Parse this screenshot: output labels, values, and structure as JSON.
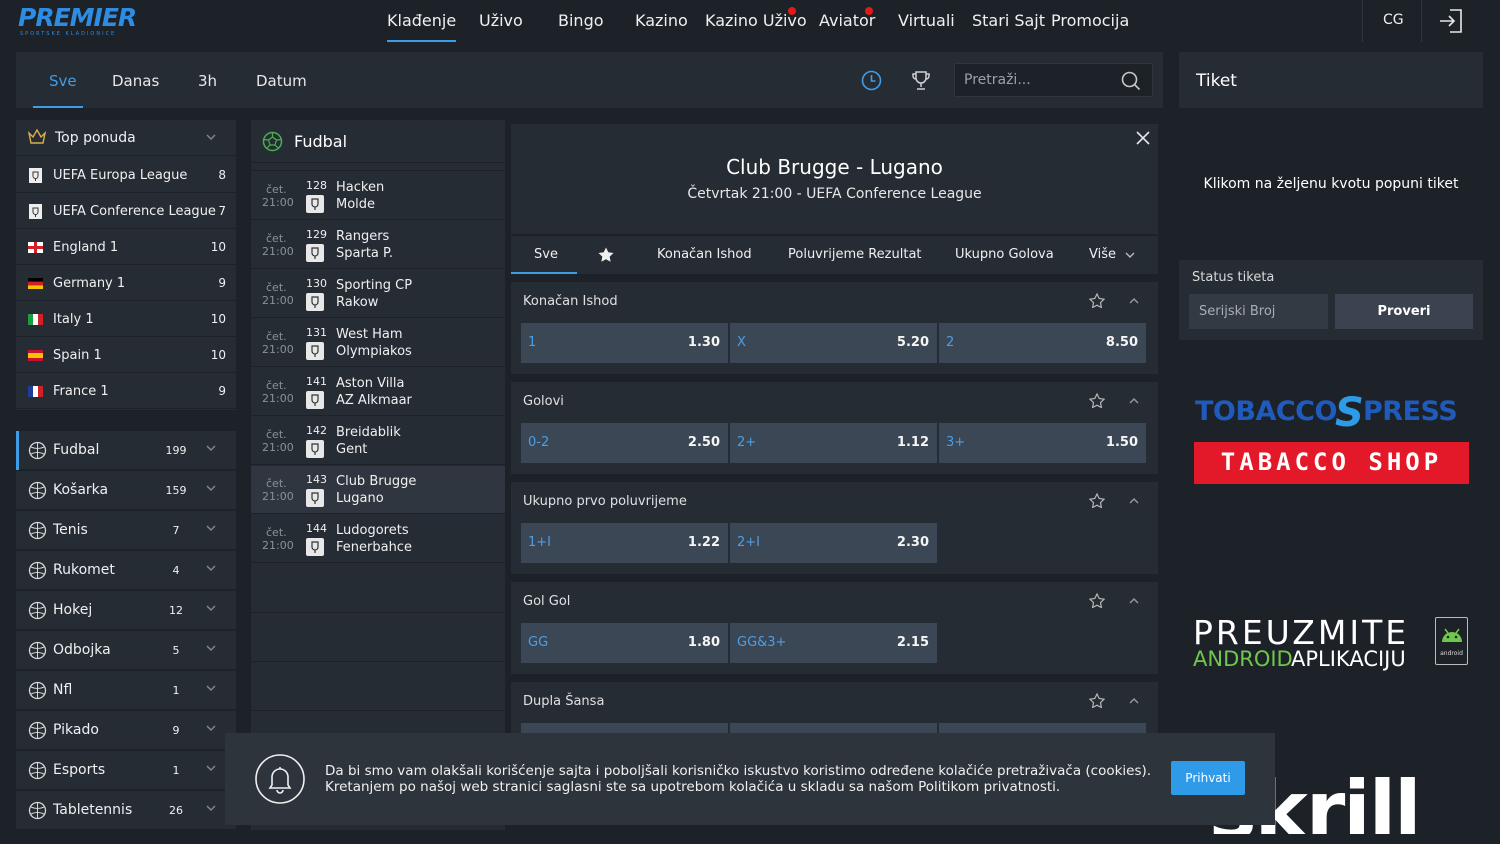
{
  "brand": {
    "name": "PREMIER",
    "tagline": "SPORTSKE KLADIONICE",
    "color": "#2e8de3"
  },
  "nav": {
    "items": [
      "Klađenje",
      "Uživo",
      "Bingo",
      "Kazino",
      "Kazino Uživo",
      "Aviator",
      "Virtuali",
      "Stari Sajt",
      "Promocija"
    ],
    "active": "Klađenje",
    "lang": "CG"
  },
  "subnav": {
    "tabs": [
      "Sve",
      "Danas",
      "3h",
      "Datum"
    ],
    "active": "Sve",
    "search_placeholder": "Pretraži..."
  },
  "leagues": {
    "top_label": "Top ponuda",
    "items": [
      {
        "name": "UEFA Europa League",
        "count": "8",
        "flag": "uefa"
      },
      {
        "name": "UEFA Conference League",
        "count": "7",
        "flag": "uefa"
      },
      {
        "name": "England 1",
        "count": "10",
        "flag": "england"
      },
      {
        "name": "Germany 1",
        "count": "9",
        "flag": "germany"
      },
      {
        "name": "Italy 1",
        "count": "10",
        "flag": "italy"
      },
      {
        "name": "Spain 1",
        "count": "10",
        "flag": "spain"
      },
      {
        "name": "France 1",
        "count": "9",
        "flag": "france"
      }
    ]
  },
  "sports": [
    {
      "name": "Fudbal",
      "count": "199",
      "icon": "soccer-icon"
    },
    {
      "name": "Košarka",
      "count": "159",
      "icon": "basketball-icon"
    },
    {
      "name": "Tenis",
      "count": "7",
      "icon": "tennis-icon"
    },
    {
      "name": "Rukomet",
      "count": "4",
      "icon": "handball-icon"
    },
    {
      "name": "Hokej",
      "count": "12",
      "icon": "hockey-icon"
    },
    {
      "name": "Odbojka",
      "count": "5",
      "icon": "volleyball-icon"
    },
    {
      "name": "Nfl",
      "count": "1",
      "icon": "football-icon"
    },
    {
      "name": "Pikado",
      "count": "9",
      "icon": "darts-icon"
    },
    {
      "name": "Esports",
      "count": "1",
      "icon": "gamepad-icon"
    },
    {
      "name": "Tabletennis",
      "count": "26",
      "icon": "pingpong-icon"
    }
  ],
  "matches": {
    "sport_title": "Fudbal",
    "items": [
      {
        "day": "čet.",
        "time": "21:00",
        "num": "128",
        "home": "Hacken",
        "away": "Molde"
      },
      {
        "day": "čet.",
        "time": "21:00",
        "num": "129",
        "home": "Rangers",
        "away": "Sparta P."
      },
      {
        "day": "čet.",
        "time": "21:00",
        "num": "130",
        "home": "Sporting CP",
        "away": "Rakow"
      },
      {
        "day": "čet.",
        "time": "21:00",
        "num": "131",
        "home": "West Ham",
        "away": "Olympiakos"
      },
      {
        "day": "čet.",
        "time": "21:00",
        "num": "141",
        "home": "Aston Villa",
        "away": "AZ Alkmaar"
      },
      {
        "day": "čet.",
        "time": "21:00",
        "num": "142",
        "home": "Breidablik",
        "away": "Gent"
      },
      {
        "day": "čet.",
        "time": "21:00",
        "num": "143",
        "home": "Club Brugge",
        "away": "Lugano"
      },
      {
        "day": "čet.",
        "time": "21:00",
        "num": "144",
        "home": "Ludogorets",
        "away": "Fenerbahce"
      }
    ]
  },
  "detail": {
    "title": "Club Brugge - Lugano",
    "subtitle": "Četvrtak 21:00 - UEFA Conference League",
    "tabs": [
      "Sve",
      "Konačan Ishod",
      "Poluvrijeme Rezultat",
      "Ukupno Golova",
      "Više"
    ],
    "markets": [
      {
        "title": "Konačan Ishod",
        "odds": [
          {
            "label": "1",
            "value": "1.30"
          },
          {
            "label": "X",
            "value": "5.20"
          },
          {
            "label": "2",
            "value": "8.50"
          }
        ]
      },
      {
        "title": "Golovi",
        "odds": [
          {
            "label": "0-2",
            "value": "2.50"
          },
          {
            "label": "2+",
            "value": "1.12"
          },
          {
            "label": "3+",
            "value": "1.50"
          }
        ]
      },
      {
        "title": "Ukupno prvo poluvrijeme",
        "odds": [
          {
            "label": "1+I",
            "value": "1.22"
          },
          {
            "label": "2+I",
            "value": "2.30"
          }
        ]
      },
      {
        "title": "Gol Gol",
        "odds": [
          {
            "label": "GG",
            "value": "1.80"
          },
          {
            "label": "GG&3+",
            "value": "2.15"
          }
        ]
      },
      {
        "title": "Dupla Šansa",
        "odds": []
      }
    ]
  },
  "ticket": {
    "title": "Tiket",
    "hint": "Klikom na željenu kvotu popuni tiket",
    "status_label": "Status tiketa",
    "serial_placeholder": "Serijski Broj",
    "check_button": "Proveri"
  },
  "ads": {
    "tobacco_top": "TOBACCO",
    "tobacco_press": "PRESS",
    "tobacco_shop": "TABACCO SHOP",
    "download_line1": "PREUZMITE",
    "download_line2a": "ANDROID",
    "download_line2b": "APLIKACIJU",
    "android_badge": "android",
    "skrill": "skrill"
  },
  "cookie": {
    "line1": "Da bi smo vam olakšali korišćenje sajta i poboljšali korisničko iskustvo koristimo određene kolačiće pretraživača (cookies).",
    "line2": "Kretanjem po našoj web stranici saglasni ste sa upotrebom kolačića u skladu sa našom Politikom privatnosti.",
    "accept": "Prihvati"
  }
}
